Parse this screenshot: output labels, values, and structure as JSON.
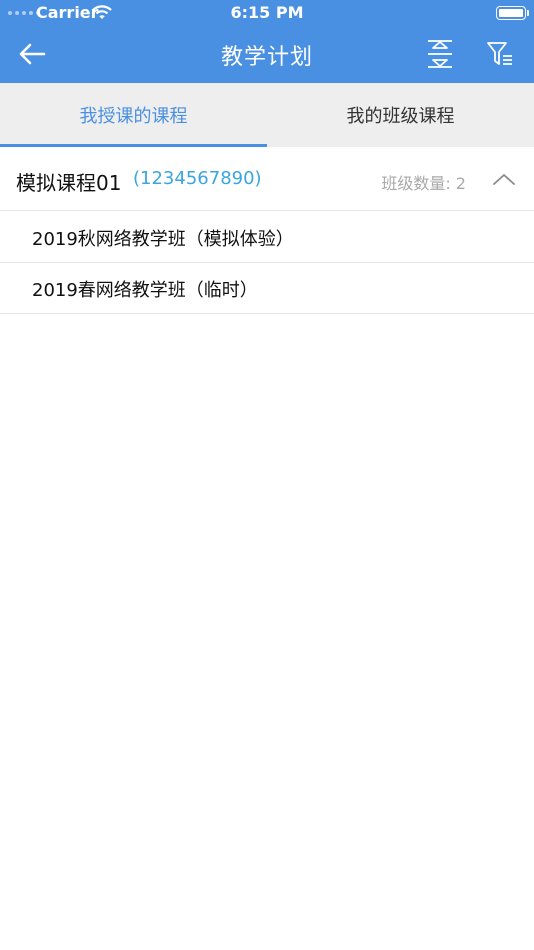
{
  "status_bar": {
    "carrier": "Carrier",
    "time": "6:15 PM"
  },
  "nav": {
    "title": "教学计划",
    "back_icon": "arrow-left-icon",
    "collapse_icon": "collapse-icon",
    "filter_icon": "filter-icon"
  },
  "tabs": [
    {
      "label": "我授课的课程",
      "active": true
    },
    {
      "label": "我的班级课程",
      "active": false
    }
  ],
  "course": {
    "name": "模拟课程01",
    "code": "(1234567890)",
    "class_count": "班级数量: 2",
    "expanded": true
  },
  "classes": [
    {
      "label": "2019秋网络教学班（模拟体验）"
    },
    {
      "label": "2019春网络教学班（临时）"
    }
  ],
  "colors": {
    "header": "#4a90e2",
    "accent": "#4a90e2",
    "code": "#3aa6dd",
    "tab_bg": "#eeeeee"
  }
}
